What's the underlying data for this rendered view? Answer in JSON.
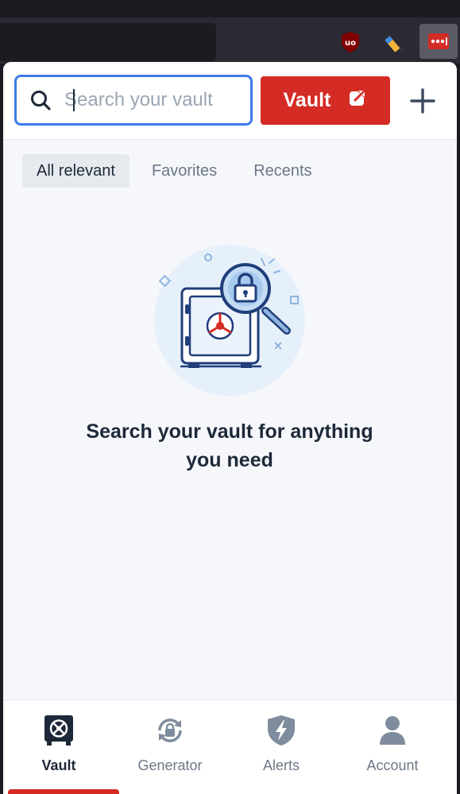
{
  "search": {
    "placeholder": "Search your vault"
  },
  "header": {
    "vault_label": "Vault"
  },
  "tabs": [
    {
      "label": "All relevant",
      "active": true
    },
    {
      "label": "Favorites",
      "active": false
    },
    {
      "label": "Recents",
      "active": false
    }
  ],
  "empty_state": {
    "line1": "Search your vault for anything",
    "line2": "you need"
  },
  "bottom_nav": [
    {
      "label": "Vault",
      "icon": "vault-icon",
      "active": true
    },
    {
      "label": "Generator",
      "icon": "generator-icon",
      "active": false
    },
    {
      "label": "Alerts",
      "icon": "alerts-icon",
      "active": false
    },
    {
      "label": "Account",
      "icon": "account-icon",
      "active": false
    }
  ],
  "colors": {
    "accent": "#d42b25",
    "focus": "#3d7be8",
    "text": "#1d2939",
    "muted": "#6b7787"
  }
}
